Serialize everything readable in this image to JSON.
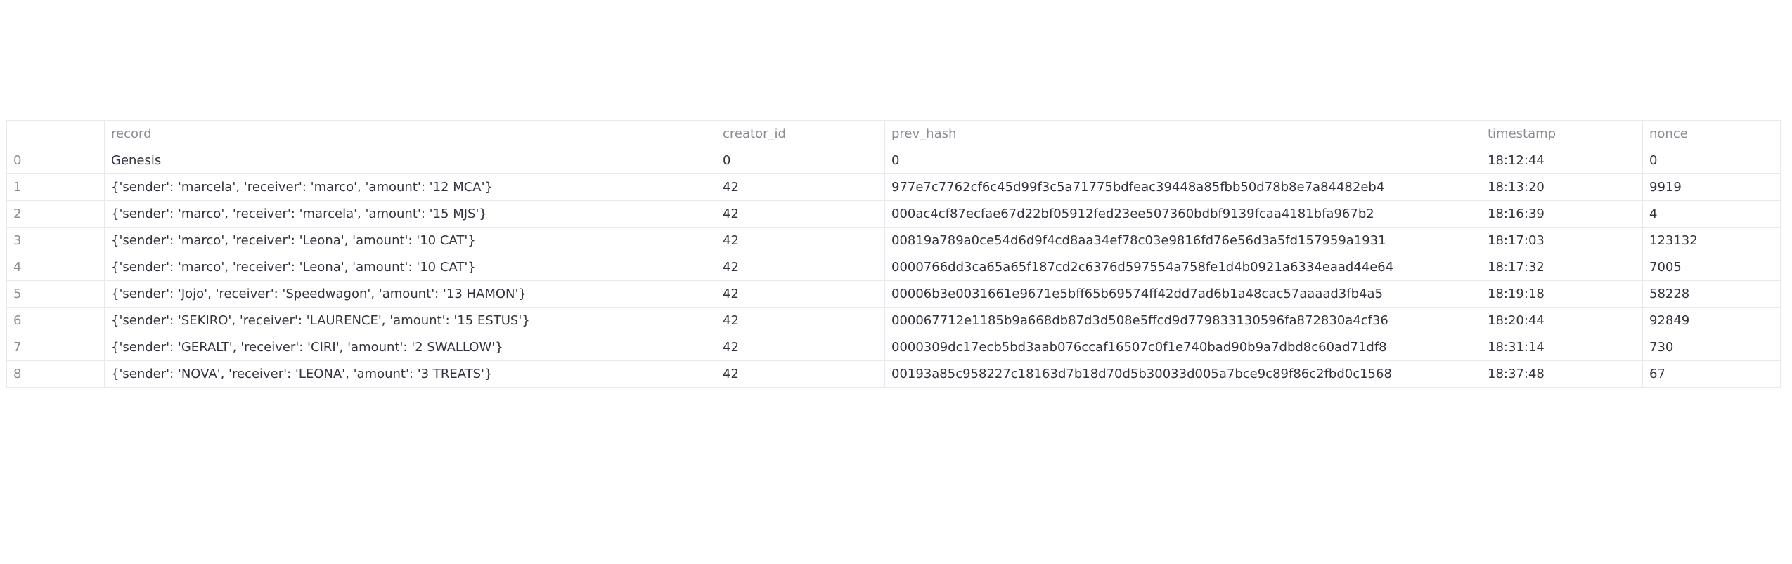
{
  "table": {
    "columns": [
      "",
      "record",
      "creator_id",
      "prev_hash",
      "timestamp",
      "nonce"
    ],
    "rows": [
      {
        "index": "0",
        "record": "Genesis",
        "creator_id": "0",
        "prev_hash": "0",
        "timestamp": "18:12:44",
        "nonce": "0"
      },
      {
        "index": "1",
        "record": "{'sender': 'marcela', 'receiver': 'marco', 'amount': '12 MCA'}",
        "creator_id": "42",
        "prev_hash": "977e7c7762cf6c45d99f3c5a71775bdfeac39448a85fbb50d78b8e7a84482eb4",
        "timestamp": "18:13:20",
        "nonce": "9919"
      },
      {
        "index": "2",
        "record": "{'sender': 'marco', 'receiver': 'marcela', 'amount': '15 MJS'}",
        "creator_id": "42",
        "prev_hash": "000ac4cf87ecfae67d22bf05912fed23ee507360bdbf9139fcaa4181bfa967b2",
        "timestamp": "18:16:39",
        "nonce": "4"
      },
      {
        "index": "3",
        "record": "{'sender': 'marco', 'receiver': 'Leona', 'amount': '10 CAT'}",
        "creator_id": "42",
        "prev_hash": "00819a789a0ce54d6d9f4cd8aa34ef78c03e9816fd76e56d3a5fd157959a1931",
        "timestamp": "18:17:03",
        "nonce": "123132"
      },
      {
        "index": "4",
        "record": "{'sender': 'marco', 'receiver': 'Leona', 'amount': '10 CAT'}",
        "creator_id": "42",
        "prev_hash": "0000766dd3ca65a65f187cd2c6376d597554a758fe1d4b0921a6334eaad44e64",
        "timestamp": "18:17:32",
        "nonce": "7005"
      },
      {
        "index": "5",
        "record": "{'sender': 'Jojo', 'receiver': 'Speedwagon', 'amount': '13 HAMON'}",
        "creator_id": "42",
        "prev_hash": "00006b3e0031661e9671e5bff65b69574ff42dd7ad6b1a48cac57aaaad3fb4a5",
        "timestamp": "18:19:18",
        "nonce": "58228"
      },
      {
        "index": "6",
        "record": "{'sender': 'SEKIRO', 'receiver': 'LAURENCE', 'amount': '15 ESTUS'}",
        "creator_id": "42",
        "prev_hash": "000067712e1185b9a668db87d3d508e5ffcd9d779833130596fa872830a4cf36",
        "timestamp": "18:20:44",
        "nonce": "92849"
      },
      {
        "index": "7",
        "record": "{'sender': 'GERALT', 'receiver': 'CIRI', 'amount': '2 SWALLOW'}",
        "creator_id": "42",
        "prev_hash": "0000309dc17ecb5bd3aab076ccaf16507c0f1e740bad90b9a7dbd8c60ad71df8",
        "timestamp": "18:31:14",
        "nonce": "730"
      },
      {
        "index": "8",
        "record": "{'sender': 'NOVA', 'receiver': 'LEONA', 'amount': '3 TREATS'}",
        "creator_id": "42",
        "prev_hash": "00193a85c958227c18163d7b18d70d5b30033d005a7bce9c89f86c2fbd0c1568",
        "timestamp": "18:37:48",
        "nonce": "67"
      }
    ]
  }
}
